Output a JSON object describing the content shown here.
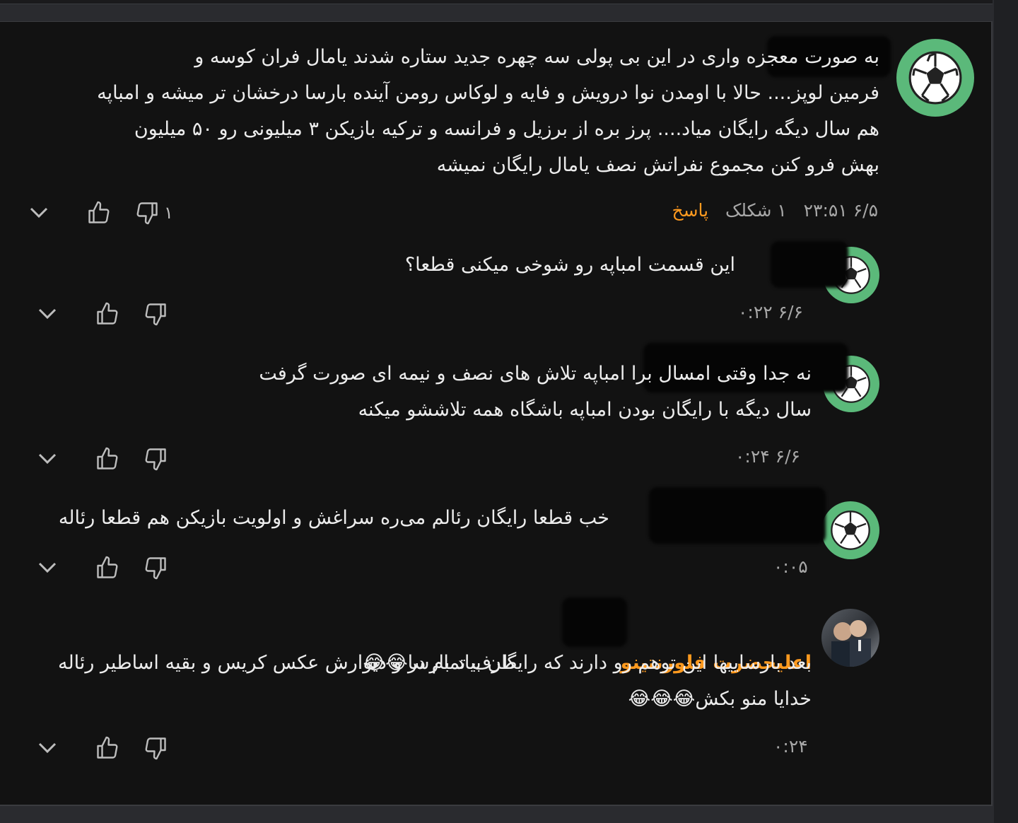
{
  "comments": [
    {
      "avatar": "soccer-ball-icon",
      "text": "به صورت معجزه واری در این بی پولی سه چهره جدید ستاره شدند یامال فران کوسه و\nفرمین لوپز.... حالا با اومدن نوا درویش و فایه و لوکاس رومن آینده بارسا درخشان تر میشه و امباپه\nهم سال دیگه رایگان میاد.... پرز بره از برزیل و فرانسه و ترکیه بازیکن ۳ میلیونی رو ۵۰ میلیون\nبهش فرو کنن مجموع نفراتش نصف یامال رایگان نمیشه",
      "timestamp": "۶/۵ ۲۳:۵۱",
      "likes_label": "۱ شکلک",
      "reply_label": "پاسخ",
      "dislike_count": "۱"
    },
    {
      "avatar": "soccer-ball-icon",
      "text": "این قسمت امباپه رو شوخی میکنی قطعا؟",
      "timestamp": "۶/۶ ۰:۲۲"
    },
    {
      "avatar": "soccer-ball-icon",
      "text": "نه جدا وقتی امسال برا امباپه تلاش های نصف و نیمه ای صورت گرفت\nسال دیگه با رایگان بودن امباپه باشگاه همه تلاششو میکنه",
      "timestamp": "۶/۶ ۰:۲۴"
    },
    {
      "avatar": "soccer-ball-icon",
      "text": "خب قطعا رایگان رئالم می‌ره سراغش و اولویت بازیکن هم قطعا رئاله",
      "timestamp": "۰:۰۵"
    },
    {
      "avatar": "user-photo",
      "author": "اعلیحضرت فلورنتینو",
      "text_line1": "طرف تمام در و دیوارش عکس کریس و بقیه اساطیر رئاله",
      "text_rest": "بعد بارساییها این توهم رو دارند که رایگان بیاد بارسا😂😂\nخدایا منو بکش😂😂😂",
      "timestamp": "۰:۲۴"
    }
  ]
}
